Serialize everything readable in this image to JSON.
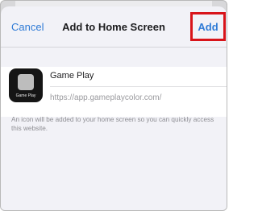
{
  "nav": {
    "cancel_label": "Cancel",
    "title": "Add to Home Screen",
    "add_label": "Add",
    "highlight_color": "#d8141a"
  },
  "app": {
    "icon_label": "Game Play",
    "name": "Game Play",
    "url": "https://app.gameplaycolor.com/"
  },
  "info_text": "An icon will be added to your home screen so you can quickly access this website."
}
